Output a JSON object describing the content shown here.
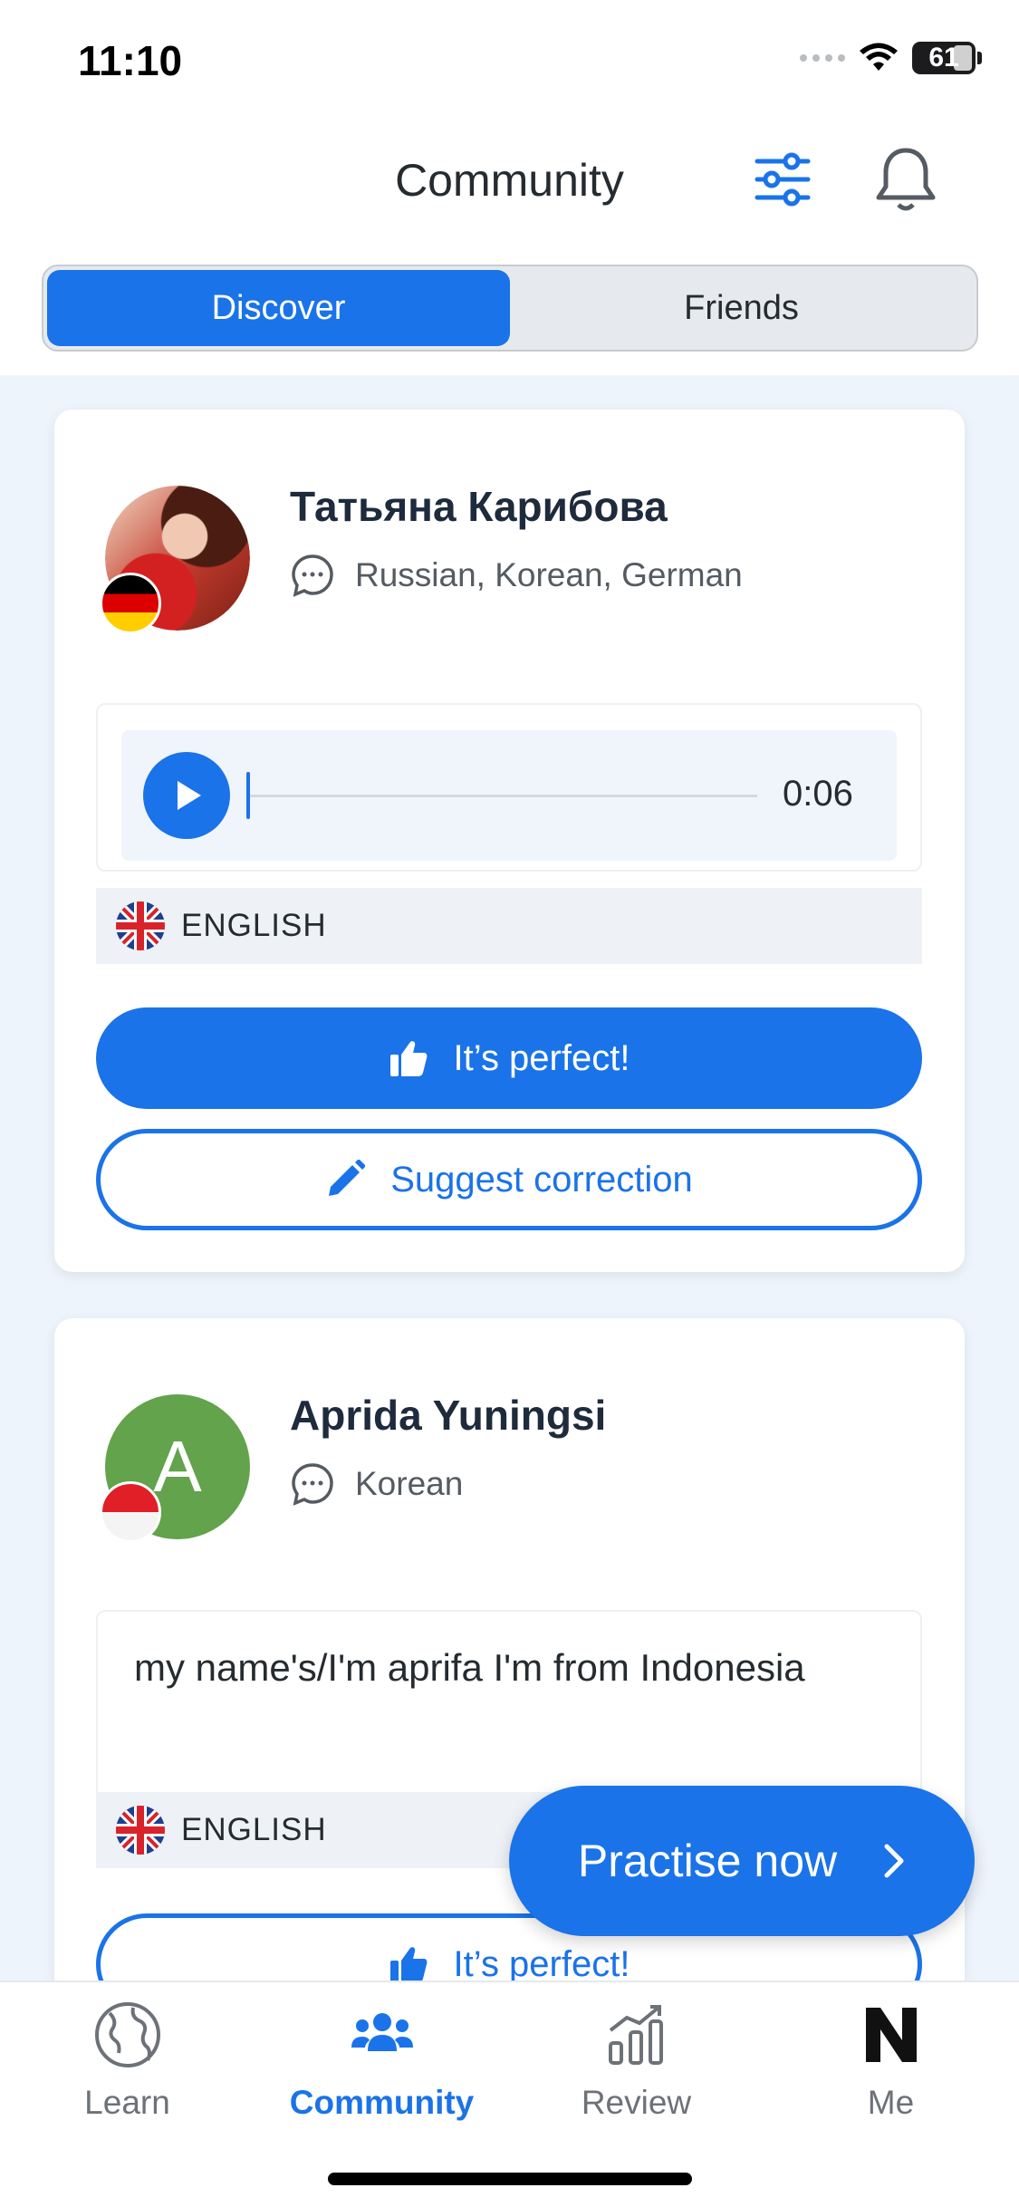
{
  "status": {
    "time": "11:10",
    "battery": "61"
  },
  "header": {
    "title": "Community"
  },
  "segments": {
    "discover": "Discover",
    "friends": "Friends"
  },
  "posts": [
    {
      "name": "Татьяна Карибова",
      "languages": "Russian, Korean, German",
      "flag": "germany",
      "type": "audio",
      "audio_duration": "0:06",
      "audio_progress": 0,
      "post_language": "ENGLISH",
      "perfect_label": "It’s perfect!",
      "suggest_label": "Suggest correction"
    },
    {
      "name": "Aprida Yuningsi",
      "avatar_letter": "A",
      "languages": "Korean",
      "flag": "indonesia",
      "type": "text",
      "text": "my name's/I'm aprifa I'm from Indonesia",
      "post_language": "ENGLISH",
      "perfect_label": "It’s perfect!"
    }
  ],
  "fab": {
    "label": "Practise now"
  },
  "tabbar": {
    "items": [
      {
        "label": "Learn",
        "icon": "globe-icon",
        "active": false
      },
      {
        "label": "Community",
        "icon": "people-icon",
        "active": true
      },
      {
        "label": "Review",
        "icon": "bar-chart-icon",
        "active": false
      },
      {
        "label": "Me",
        "icon": "profile-n-icon",
        "active": false
      }
    ]
  },
  "colors": {
    "accent": "#1a73e8",
    "background": "#eef4fb",
    "text": "#252b2f"
  }
}
